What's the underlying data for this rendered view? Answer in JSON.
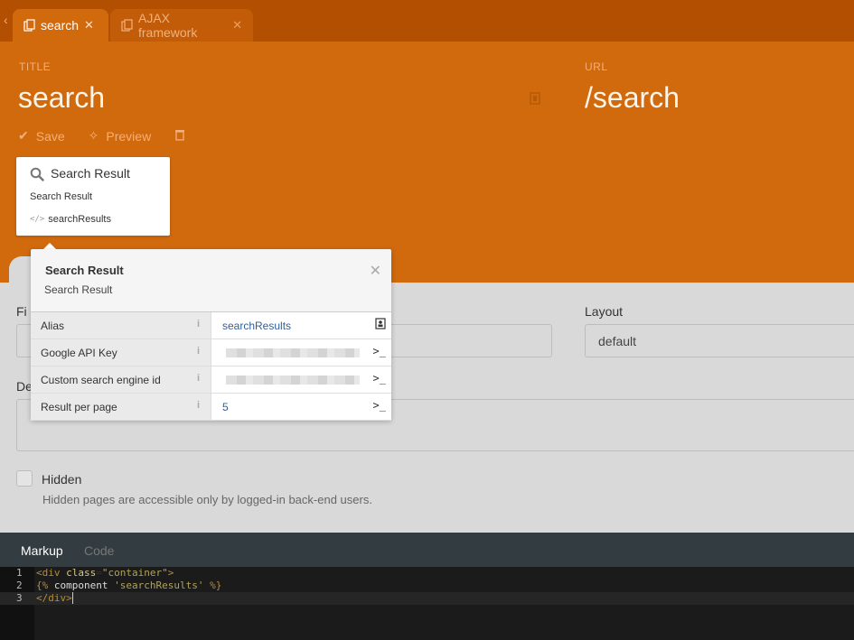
{
  "tabs": [
    {
      "label": "search",
      "icon": "page-icon",
      "active": true
    },
    {
      "label": "AJAX framework",
      "icon": "page-icon",
      "active": false
    }
  ],
  "header": {
    "title_label": "TITLE",
    "title": "search",
    "url_label": "URL",
    "url": "/search",
    "save_label": "Save",
    "preview_label": "Preview"
  },
  "component": {
    "title": "Search Result",
    "description": "Search Result",
    "alias": "searchResults"
  },
  "inspector": {
    "title": "Search Result",
    "subtitle": "Search Result",
    "rows": [
      {
        "key": "Alias",
        "value": "searchResults"
      },
      {
        "key": "Google API Key",
        "value": ""
      },
      {
        "key": "Custom search engine id",
        "value": ""
      },
      {
        "key": "Result per page",
        "value": "5"
      }
    ]
  },
  "form": {
    "file_label": "Fi",
    "layout_label": "Layout",
    "layout_value": "default",
    "desc_label": "De",
    "hidden_label": "Hidden",
    "hidden_help": "Hidden pages are accessible only by logged-in back-end users."
  },
  "editor": {
    "tabs": [
      "Markup",
      "Code"
    ],
    "lines": [
      "1",
      "2",
      "3"
    ]
  },
  "colors": {
    "header": "#d1690d",
    "tabbar": "#b34f00",
    "editor": "#1b1b1b"
  }
}
